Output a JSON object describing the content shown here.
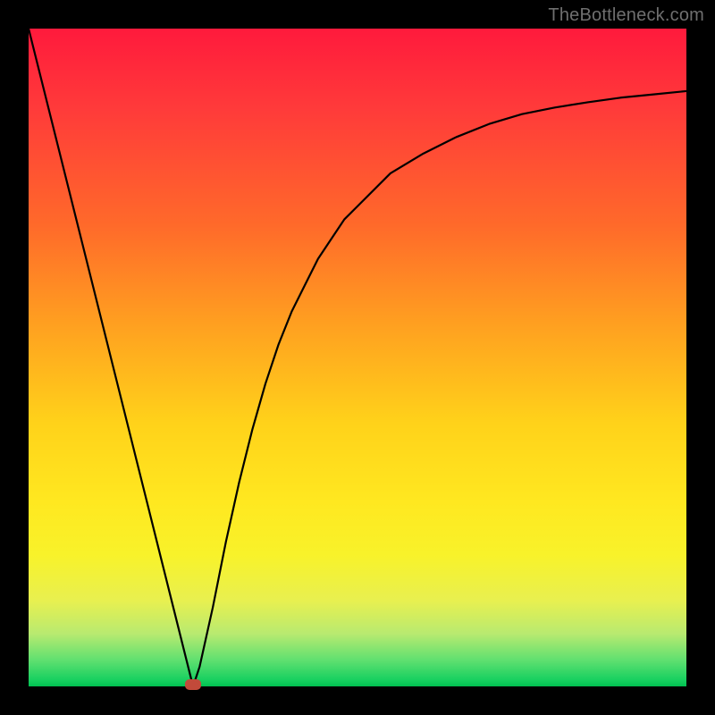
{
  "watermark": {
    "text": "TheBottleneck.com"
  },
  "chart_data": {
    "type": "line",
    "title": "",
    "xlabel": "",
    "ylabel": "",
    "xlim": [
      0,
      100
    ],
    "ylim": [
      0,
      100
    ],
    "grid": false,
    "legend": false,
    "series": [
      {
        "name": "bottleneck-curve",
        "x": [
          0,
          2,
          4,
          6,
          8,
          10,
          12,
          14,
          16,
          18,
          20,
          22,
          24,
          25,
          26,
          28,
          30,
          32,
          34,
          36,
          38,
          40,
          42,
          44,
          46,
          48,
          50,
          55,
          60,
          65,
          70,
          75,
          80,
          85,
          90,
          95,
          100
        ],
        "y": [
          100,
          92,
          84,
          76,
          68,
          60,
          52,
          44,
          36,
          28,
          20,
          12,
          4,
          0,
          3,
          12,
          22,
          31,
          39,
          46,
          52,
          57,
          61,
          65,
          68,
          71,
          73,
          78,
          81,
          83.5,
          85.5,
          87,
          88,
          88.8,
          89.5,
          90,
          90.5
        ]
      }
    ],
    "marker": {
      "name": "optimal-point",
      "x": 25,
      "y": 0,
      "color": "#c24a3a",
      "shape": "rounded-rect"
    },
    "background_gradient": {
      "top": "#ff1a3c",
      "upper_mid": "#ffa020",
      "mid": "#ffe820",
      "lower_mid": "#b8ea70",
      "bottom": "#00c050"
    }
  }
}
